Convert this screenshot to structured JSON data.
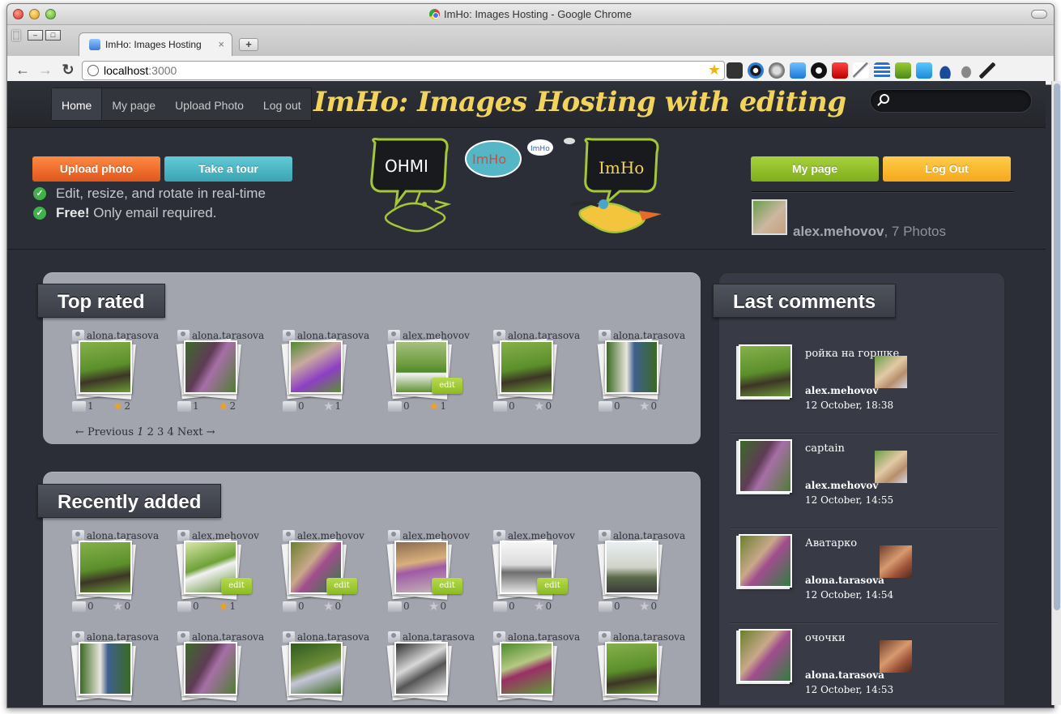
{
  "window": {
    "title": "ImHo: Images Hosting - Google Chrome"
  },
  "tab": {
    "title": "ImHo: Images Hosting",
    "close": "×",
    "new": "+"
  },
  "address": {
    "host": "localhost",
    "port": ":3000"
  },
  "nav": {
    "items": [
      "Home",
      "My page",
      "Upload Photo",
      "Log out"
    ],
    "brand": "ImHo: Images Hosting with editing"
  },
  "hero": {
    "upload_label": "Upload photo",
    "tour_label": "Take a tour",
    "feature1": "Edit, resize, and rotate in real-time",
    "feature2_bold": "Free!",
    "feature2_rest": " Only email required.",
    "mypage_label": "My page",
    "logout_label": "Log Out",
    "username": "alex.mehovov",
    "photos_text": ", 7 Photos",
    "logo_words": [
      "OHMI",
      "ImHo",
      "ImHo",
      "ImHo"
    ]
  },
  "top_rated": {
    "title": "Top rated",
    "tiles": [
      {
        "owner": "alona.tarasova",
        "comments": "1",
        "rating": "2",
        "gold": true,
        "photo": "ph-e",
        "edit": false
      },
      {
        "owner": "alona.tarasova",
        "comments": "1",
        "rating": "2",
        "gold": true,
        "photo": "ph-b",
        "edit": false
      },
      {
        "owner": "alona.tarasova",
        "comments": "0",
        "rating": "1",
        "gold": false,
        "photo": "ph-c",
        "edit": false
      },
      {
        "owner": "alex.mehovov",
        "comments": "0",
        "rating": "1",
        "gold": true,
        "photo": "ph-d",
        "edit": true
      },
      {
        "owner": "alona.tarasova",
        "comments": "0",
        "rating": "0",
        "gold": false,
        "photo": "ph-e",
        "edit": false
      },
      {
        "owner": "alona.tarasova",
        "comments": "0",
        "rating": "0",
        "gold": false,
        "photo": "ph-f",
        "edit": false
      }
    ],
    "pager": {
      "prev": "← Previous",
      "current": "1",
      "pages": [
        "2",
        "3",
        "4"
      ],
      "next": "Next →"
    }
  },
  "recent": {
    "title": "Recently added",
    "row1": [
      {
        "owner": "alona.tarasova",
        "comments": "0",
        "rating": "0",
        "gold": false,
        "photo": "ph-e",
        "edit": false
      },
      {
        "owner": "alex.mehovov",
        "comments": "0",
        "rating": "1",
        "gold": true,
        "photo": "ph-g",
        "edit": true
      },
      {
        "owner": "alex.mehovov",
        "comments": "0",
        "rating": "0",
        "gold": false,
        "photo": "ph-h",
        "edit": true
      },
      {
        "owner": "alex.mehovov",
        "comments": "0",
        "rating": "0",
        "gold": false,
        "photo": "ph-i",
        "edit": true
      },
      {
        "owner": "alex.mehovov",
        "comments": "0",
        "rating": "0",
        "gold": false,
        "photo": "ph-k",
        "edit": true
      },
      {
        "owner": "alona.tarasova",
        "comments": "0",
        "rating": "0",
        "gold": false,
        "photo": "ph-j",
        "edit": false
      }
    ],
    "row2": [
      {
        "owner": "alona.tarasova",
        "photo": "ph-f"
      },
      {
        "owner": "alona.tarasova",
        "photo": "ph-b"
      },
      {
        "owner": "alona.tarasova",
        "photo": "ph-a"
      },
      {
        "owner": "alona.tarasova",
        "photo": "ph-l"
      },
      {
        "owner": "alona.tarasova",
        "photo": "ph-m"
      },
      {
        "owner": "alona.tarasova",
        "photo": "ph-e"
      }
    ],
    "edit_label": "edit"
  },
  "comments": {
    "title": "Last comments",
    "items": [
      {
        "text": "ройка на горшке",
        "user": "alex.mehovov",
        "date": "12 October, 18:38",
        "photo": "ph-e",
        "avatar": "av-alex"
      },
      {
        "text": "captain",
        "user": "alex.mehovov",
        "date": "12 October, 14:55",
        "photo": "ph-b",
        "avatar": "av-alex"
      },
      {
        "text": "Аватарко",
        "user": "alona.tarasova",
        "date": "12 October, 14:54",
        "photo": "ph-h",
        "avatar": "av-alona"
      },
      {
        "text": "очочки",
        "user": "alona.tarasova",
        "date": "12 October, 14:53",
        "photo": "ph-h",
        "avatar": "av-alona"
      }
    ]
  },
  "colors": {
    "brand": "#f2d45c",
    "orange": "#e8652a",
    "teal": "#4bb7c4",
    "green": "#8cbf2a",
    "yellow": "#f7b52a",
    "panel": "#a2a4ae"
  }
}
